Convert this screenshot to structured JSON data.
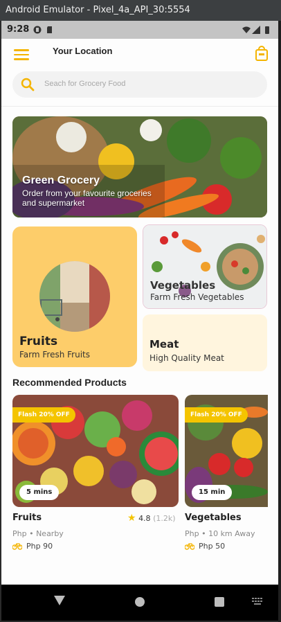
{
  "window": {
    "title": "Android Emulator - Pixel_4a_API_30:5554"
  },
  "status_bar": {
    "time": "9:28"
  },
  "header": {
    "title": "Your Location"
  },
  "search": {
    "placeholder": "Seach for Grocery Food"
  },
  "banner": {
    "title": "Green Grocery",
    "subtitle": "Order from your favourite groceries and supermarket"
  },
  "categories": {
    "fruits": {
      "title": "Fruits",
      "subtitle": "Farm Fresh Fruits"
    },
    "vegetables": {
      "title": "Vegetables",
      "subtitle": "Farm Fresh Vegetables"
    },
    "meat": {
      "title": "Meat",
      "subtitle": "High Quality Meat"
    }
  },
  "recommended": {
    "title": "Recommended Products",
    "products": [
      {
        "badge": "Flash 20% OFF",
        "eta": "5 mins",
        "name": "Fruits",
        "rating": "4.8",
        "rating_count": "(1.2k)",
        "location": "Php • Nearby",
        "delivery": "Php  90"
      },
      {
        "badge": "Flash 20% OFF",
        "eta": "15 min",
        "name": "Vegetables",
        "location": "Php • 10 km Away",
        "delivery": "Php  50"
      }
    ]
  },
  "colors": {
    "accent": "#f4b400",
    "fruits_card": "#fdcd6a",
    "meat_card": "#fff5de"
  }
}
